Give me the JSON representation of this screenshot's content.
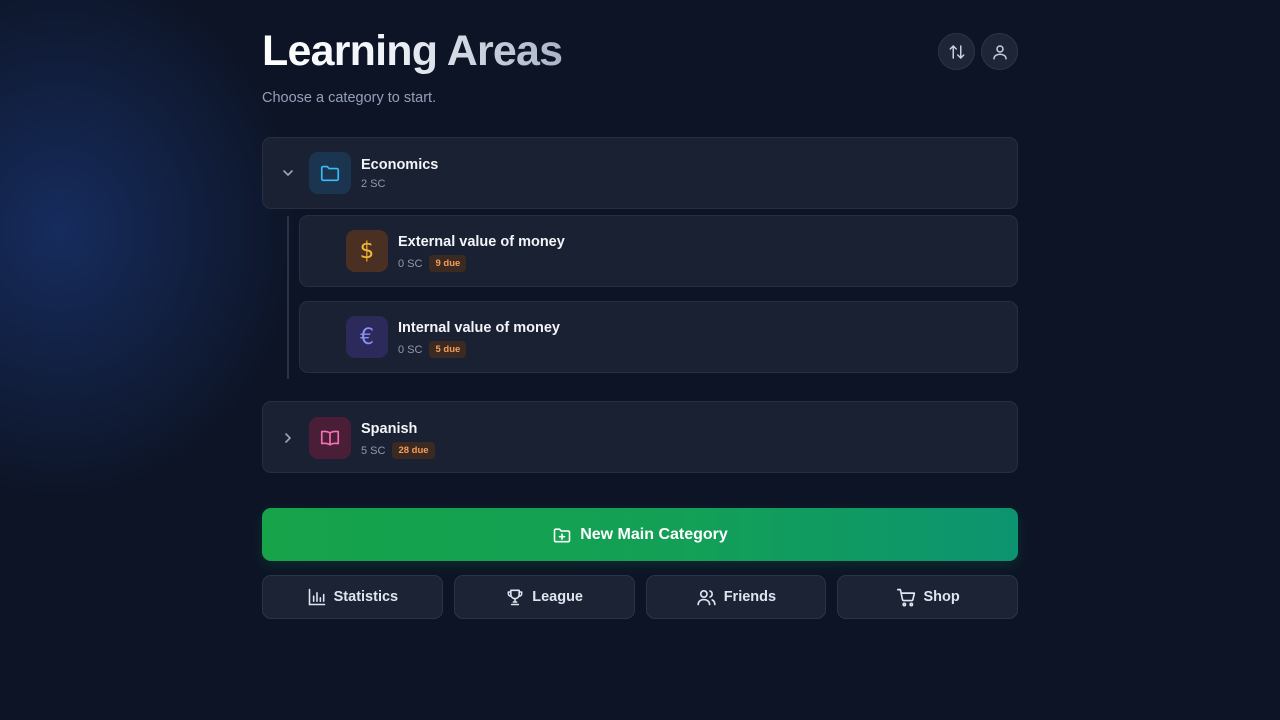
{
  "header": {
    "title": "Learning Areas",
    "subtitle": "Choose a category to start."
  },
  "icons": {
    "sort": "sort-arrows-icon",
    "user": "user-icon"
  },
  "categories": [
    {
      "name": "Economics",
      "meta": "2 SC",
      "expanded": true,
      "icon": "folder-icon",
      "color": "#38bdf8",
      "children": [
        {
          "name": "External value of money",
          "meta": "0 SC",
          "due": "9 due",
          "icon": "dollar-icon",
          "color": "#f5b731"
        },
        {
          "name": "Internal value of money",
          "meta": "0 SC",
          "due": "5 due",
          "icon": "euro-icon",
          "color": "#8b8cf6"
        }
      ]
    },
    {
      "name": "Spanish",
      "meta": "5 SC",
      "due": "28 due",
      "expanded": false,
      "icon": "book-icon",
      "color": "#f472b6"
    }
  ],
  "actions": {
    "new_main_category": "New Main Category",
    "statistics": "Statistics",
    "league": "League",
    "friends": "Friends",
    "shop": "Shop"
  },
  "colors": {
    "background": "#0d1426",
    "card": "#1a2133",
    "accent_green": "#16a34a",
    "due_badge": "#f59e5b"
  }
}
